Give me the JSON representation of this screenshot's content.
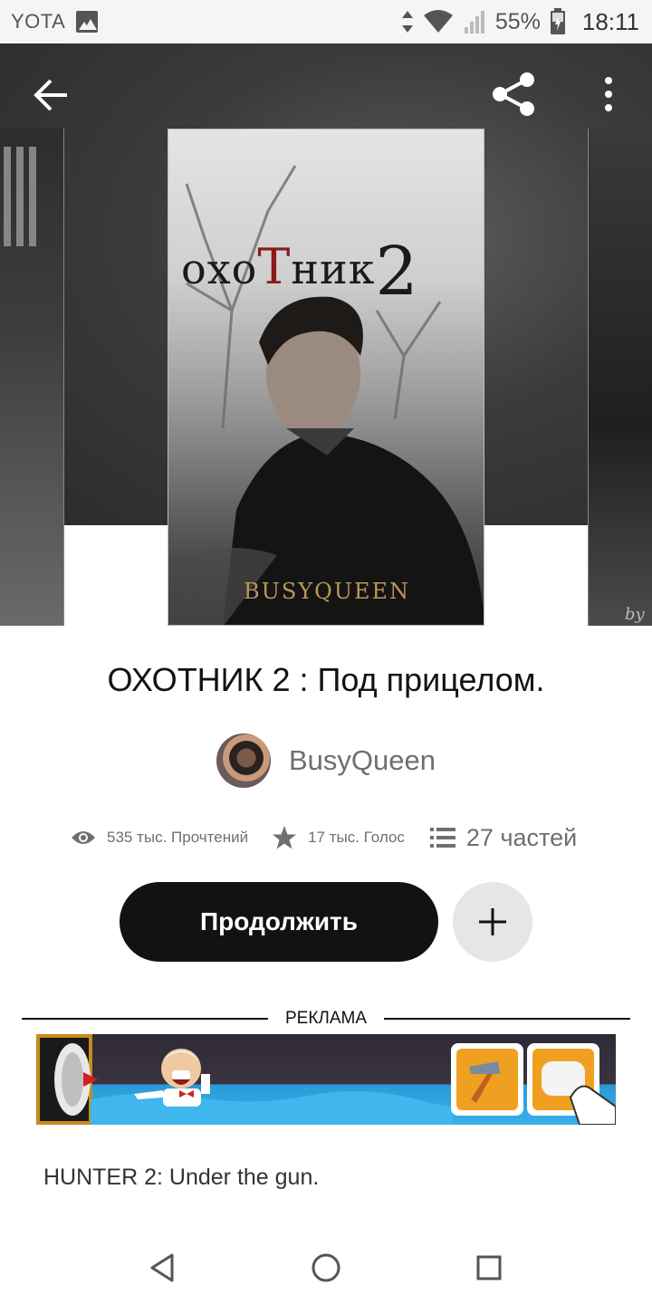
{
  "status_bar": {
    "carrier": "YOTA",
    "battery_percent": "55%",
    "time": "18:11",
    "icons": [
      "gallery-icon",
      "data-arrows-icon",
      "wifi-icon",
      "signal-icon",
      "battery-icon"
    ]
  },
  "header": {
    "icons": [
      "back-arrow-icon",
      "share-icon",
      "more-vert-icon"
    ]
  },
  "cover": {
    "title_part1": "охо",
    "title_accent": "Т",
    "title_part2": "ник",
    "title_number": "2",
    "author": "BUSYQUEEN",
    "right_cover_signature": "by"
  },
  "book": {
    "title": "ОХОТНИК 2 : Под прицелом.",
    "author": "BusyQueen",
    "reads": "535 тыс. Прочтений",
    "votes": "17 тыс. Голос",
    "parts": "27 частей",
    "description": "HUNTER 2: Under the gun."
  },
  "actions": {
    "continue_label": "Продолжить",
    "add_icon": "plus-icon"
  },
  "ad": {
    "label": "РЕКЛАМА"
  },
  "nav_bar": {
    "icons": [
      "nav-back-icon",
      "nav-home-icon",
      "nav-recent-icon"
    ]
  },
  "colors": {
    "primary_button": "#121212",
    "add_button": "#e6e6e6",
    "secondary_text": "#6f6f6f",
    "cover_accent_red": "#8b1a1a",
    "cover_author_gold": "#b8975a"
  }
}
